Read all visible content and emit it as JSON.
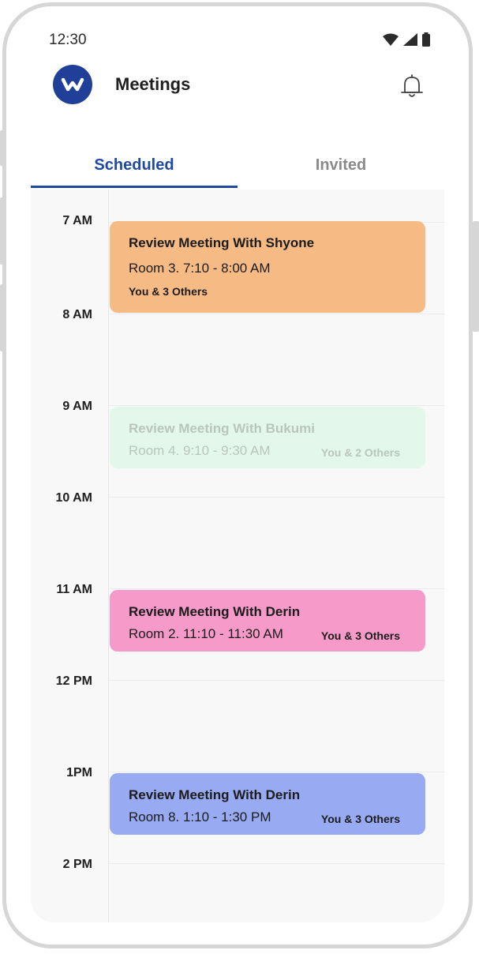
{
  "status_bar": {
    "time": "12:30",
    "icons": [
      "wifi-icon",
      "cellular-icon",
      "battery-icon"
    ]
  },
  "header": {
    "title": "Meetings",
    "logo_icon": "app-logo-icon",
    "notification_icon": "bell-icon"
  },
  "tabs": [
    {
      "label": "Scheduled",
      "active": true
    },
    {
      "label": "Invited",
      "active": false
    }
  ],
  "hours": [
    "7 AM",
    "8 AM",
    "9 AM",
    "10 AM",
    "11 AM",
    "12 PM",
    "1PM",
    "2 PM"
  ],
  "events": [
    {
      "title": "Review Meeting With Shyone",
      "room": "Room 3. 7:10 - 8:00 AM",
      "attendees": "You & 3 Others",
      "color": "#f6bb85",
      "faded": false
    },
    {
      "title": "Review Meeting With Bukumi",
      "room": "Room 4. 9:10 - 9:30 AM",
      "attendees": "You & 2 Others",
      "color": "#e3f7ea",
      "faded": true
    },
    {
      "title": "Review Meeting With Derin",
      "room": "Room 2. 11:10 - 11:30 AM",
      "attendees": "You & 3 Others",
      "color": "#f59ac9",
      "faded": false
    },
    {
      "title": "Review Meeting With Derin",
      "room": "Room 8. 1:10 - 1:30 PM",
      "attendees": "You & 3 Others",
      "color": "#97aaf2",
      "faded": false
    }
  ],
  "colors": {
    "accent": "#1f4aa3",
    "logo_bg": "#1f3f99"
  }
}
